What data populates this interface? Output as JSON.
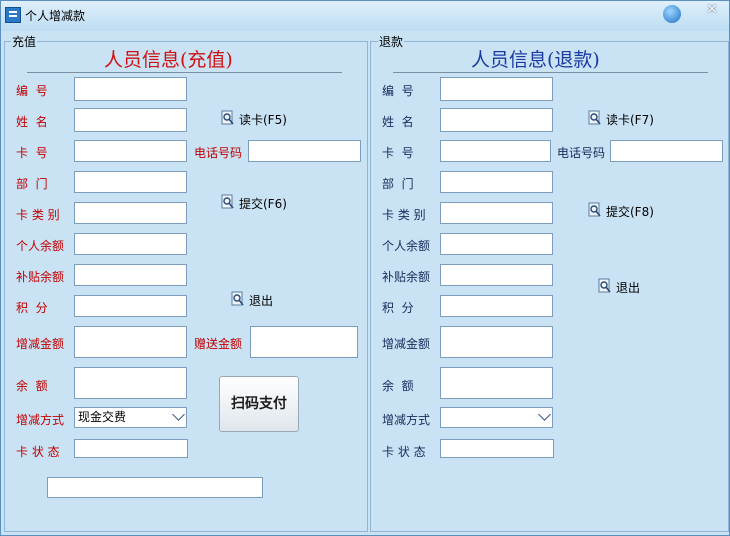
{
  "window": {
    "title": "个人增减款",
    "close_glyph": "×"
  },
  "left": {
    "legend": "充值",
    "heading": "人员信息(充值)",
    "labels": {
      "code": "编  号",
      "name": "姓  名",
      "card_no": "卡  号",
      "dept": "部  门",
      "card_type": "卡 类 别",
      "balance": "个人余额",
      "subsidy": "补贴余额",
      "points": "积  分",
      "change_amount": "增减金额",
      "remain": "余  额",
      "method": "增减方式",
      "card_status": "卡 状 态",
      "phone": "电话号码",
      "gift_amount": "赠送金额"
    },
    "method_value": "现金交费",
    "actions": {
      "read": "读卡(F5)",
      "submit": "提交(F6)",
      "exit": "退出"
    },
    "scan_button": "扫码支付"
  },
  "right": {
    "legend": "退款",
    "heading": "人员信息(退款)",
    "labels": {
      "code": "编  号",
      "name": "姓  名",
      "card_no": "卡  号",
      "dept": "部  门",
      "card_type": "卡 类 别",
      "balance": "个人余额",
      "subsidy": "补贴余额",
      "points": "积  分",
      "change_amount": "增减金额",
      "remain": "余  额",
      "method": "增减方式",
      "card_status": "卡 状 态",
      "phone": "电话号码"
    },
    "method_value": "",
    "actions": {
      "read": "读卡(F7)",
      "submit": "提交(F8)",
      "exit": "退出"
    }
  },
  "colors": {
    "left_label": "#c00000",
    "right_label": "#1a2a5a",
    "left_heading": "#d01010",
    "right_heading": "#1a3aa0"
  },
  "icons": {
    "action": "magnifier-card-icon",
    "app": "window-app-icon",
    "help": "help-orb-icon"
  }
}
